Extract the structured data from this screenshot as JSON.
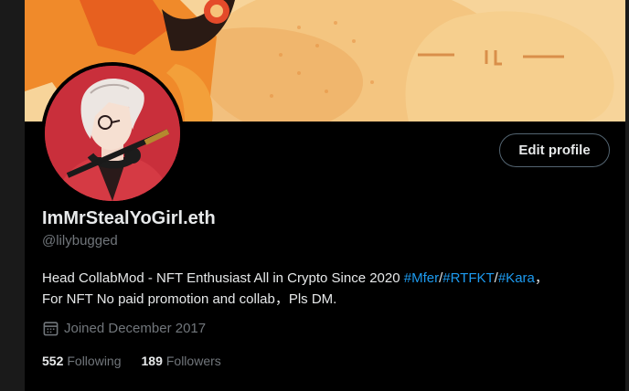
{
  "profile": {
    "display_name": "ImMrStealYoGirl.eth",
    "handle": "@lilybugged",
    "edit_button": "Edit profile",
    "bio": {
      "line1_text": "Head CollabMod - NFT Enthusiast All in Crypto Since 2020 ",
      "hashtags": [
        "#Mfer",
        "#RTFKT",
        "#Kara"
      ],
      "separator": "/",
      "line1_end": "，",
      "line2": "For NFT No paid promotion and collab，Pls DM."
    },
    "joined": "Joined December 2017",
    "following_count": "552",
    "following_label": "Following",
    "followers_count": "189",
    "followers_label": "Followers"
  },
  "icons": {
    "calendar": "calendar-icon"
  },
  "colors": {
    "background": "#000000",
    "text_primary": "#e7e9ea",
    "text_secondary": "#71767b",
    "link": "#1d9bf0",
    "button_border": "#536471",
    "avatar_bg": "#c92f3b",
    "banner_accent": "#f0a23a"
  }
}
